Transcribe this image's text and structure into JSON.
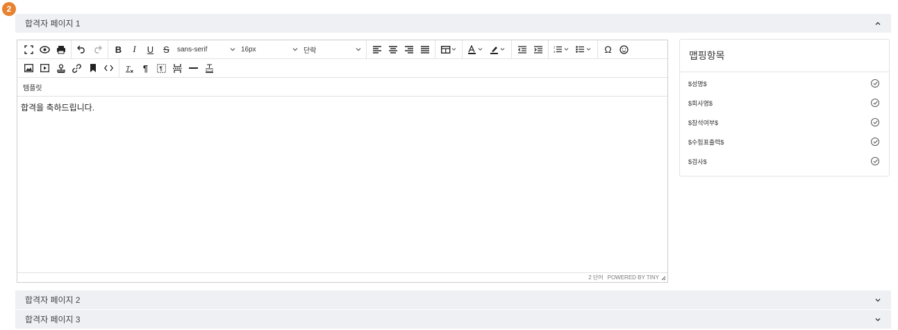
{
  "badge": "2",
  "pages": [
    {
      "title": "합격자 페이지 1",
      "expanded": true
    },
    {
      "title": "합격자 페이지 2",
      "expanded": false
    },
    {
      "title": "합격자 페이지 3",
      "expanded": false
    }
  ],
  "editor": {
    "font_family": "sans-serif",
    "font_size": "16px",
    "block_format": "단락",
    "menu_label": "템플릿",
    "content": "합격을 축하드립니다.",
    "word_count": "2 단어",
    "powered_by": "POWERED BY TINY"
  },
  "mapping": {
    "title": "맵핑항목",
    "items": [
      "$성명$",
      "$회사명$",
      "$참석여부$",
      "$수험표출력$",
      "$검사$"
    ]
  }
}
